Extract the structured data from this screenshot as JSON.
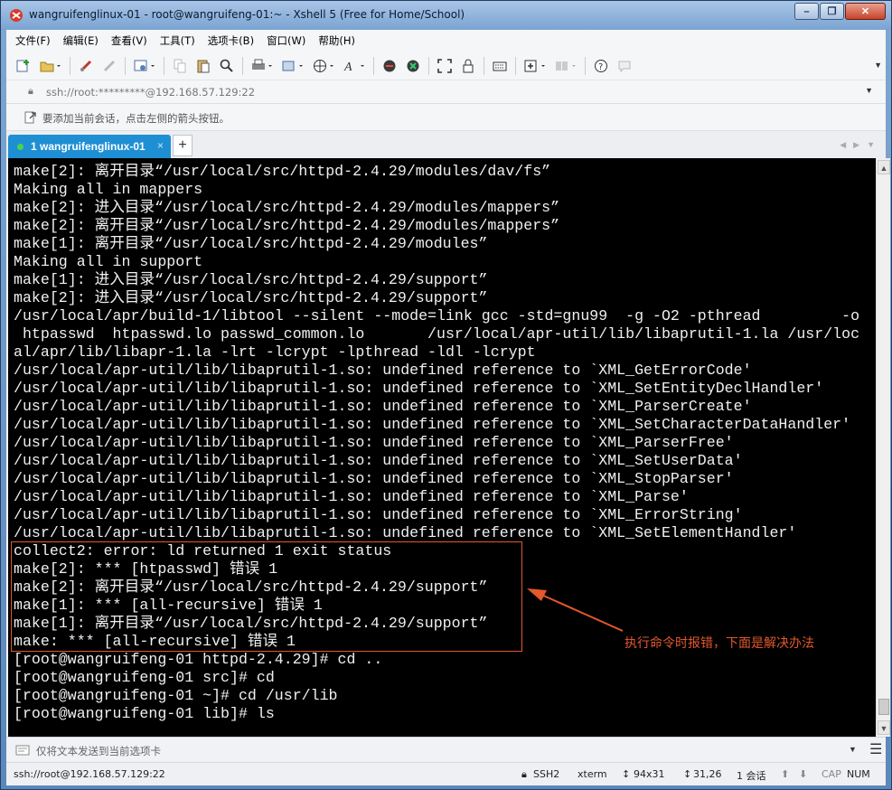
{
  "window": {
    "title": "wangruifenglinux-01 - root@wangruifeng-01:~ - Xshell 5 (Free for Home/School)",
    "minimize": "–",
    "restore": "❐",
    "close": "✕"
  },
  "menu": [
    "文件(F)",
    "编辑(E)",
    "查看(V)",
    "工具(T)",
    "选项卡(B)",
    "窗口(W)",
    "帮助(H)"
  ],
  "address": {
    "text": "ssh://root:*********@192.168.57.129:22"
  },
  "hint": {
    "text": "要添加当前会话，点击左侧的箭头按钮。"
  },
  "tab": {
    "label": "1 wangruifenglinux-01",
    "close": "×",
    "add": "+"
  },
  "terminal": {
    "lines": [
      "make[2]: 离开目录“/usr/local/src/httpd-2.4.29/modules/dav/fs”",
      "Making all in mappers",
      "make[2]: 进入目录“/usr/local/src/httpd-2.4.29/modules/mappers”",
      "make[2]: 离开目录“/usr/local/src/httpd-2.4.29/modules/mappers”",
      "make[1]: 离开目录“/usr/local/src/httpd-2.4.29/modules”",
      "Making all in support",
      "make[1]: 进入目录“/usr/local/src/httpd-2.4.29/support”",
      "make[2]: 进入目录“/usr/local/src/httpd-2.4.29/support”",
      "/usr/local/apr/build-1/libtool --silent --mode=link gcc -std=gnu99  -g -O2 -pthread         -o",
      " htpasswd  htpasswd.lo passwd_common.lo       /usr/local/apr-util/lib/libaprutil-1.la /usr/loc",
      "al/apr/lib/libapr-1.la -lrt -lcrypt -lpthread -ldl -lcrypt",
      "/usr/local/apr-util/lib/libaprutil-1.so: undefined reference to `XML_GetErrorCode'",
      "/usr/local/apr-util/lib/libaprutil-1.so: undefined reference to `XML_SetEntityDeclHandler'",
      "/usr/local/apr-util/lib/libaprutil-1.so: undefined reference to `XML_ParserCreate'",
      "/usr/local/apr-util/lib/libaprutil-1.so: undefined reference to `XML_SetCharacterDataHandler'",
      "/usr/local/apr-util/lib/libaprutil-1.so: undefined reference to `XML_ParserFree'",
      "/usr/local/apr-util/lib/libaprutil-1.so: undefined reference to `XML_SetUserData'",
      "/usr/local/apr-util/lib/libaprutil-1.so: undefined reference to `XML_StopParser'",
      "/usr/local/apr-util/lib/libaprutil-1.so: undefined reference to `XML_Parse'",
      "/usr/local/apr-util/lib/libaprutil-1.so: undefined reference to `XML_ErrorString'",
      "/usr/local/apr-util/lib/libaprutil-1.so: undefined reference to `XML_SetElementHandler'",
      "collect2: error: ld returned 1 exit status",
      "make[2]: *** [htpasswd] 错误 1",
      "make[2]: 离开目录“/usr/local/src/httpd-2.4.29/support”",
      "make[1]: *** [all-recursive] 错误 1",
      "make[1]: 离开目录“/usr/local/src/httpd-2.4.29/support”",
      "make: *** [all-recursive] 错误 1",
      "[root@wangruifeng-01 httpd-2.4.29]# cd ..",
      "[root@wangruifeng-01 src]# cd",
      "[root@wangruifeng-01 ~]# cd /usr/lib",
      "[root@wangruifeng-01 lib]# ls"
    ],
    "annotation": "执行命令时报错，下面是解决办法",
    "annotation_color": "#e4582c"
  },
  "sendbar": {
    "text": "仅将文本发送到当前选项卡"
  },
  "status": {
    "connection": "ssh://root@192.168.57.129:22",
    "protocol": "SSH2",
    "term": "xterm",
    "size": "94x31",
    "cursor": "31,26",
    "sessions": "1 会话",
    "caps": "CAP",
    "num": "NUM"
  },
  "colors": {
    "tab_active": "#1f8fd4",
    "terminal_bg": "#000000",
    "terminal_fg": "#f0f0f0"
  }
}
